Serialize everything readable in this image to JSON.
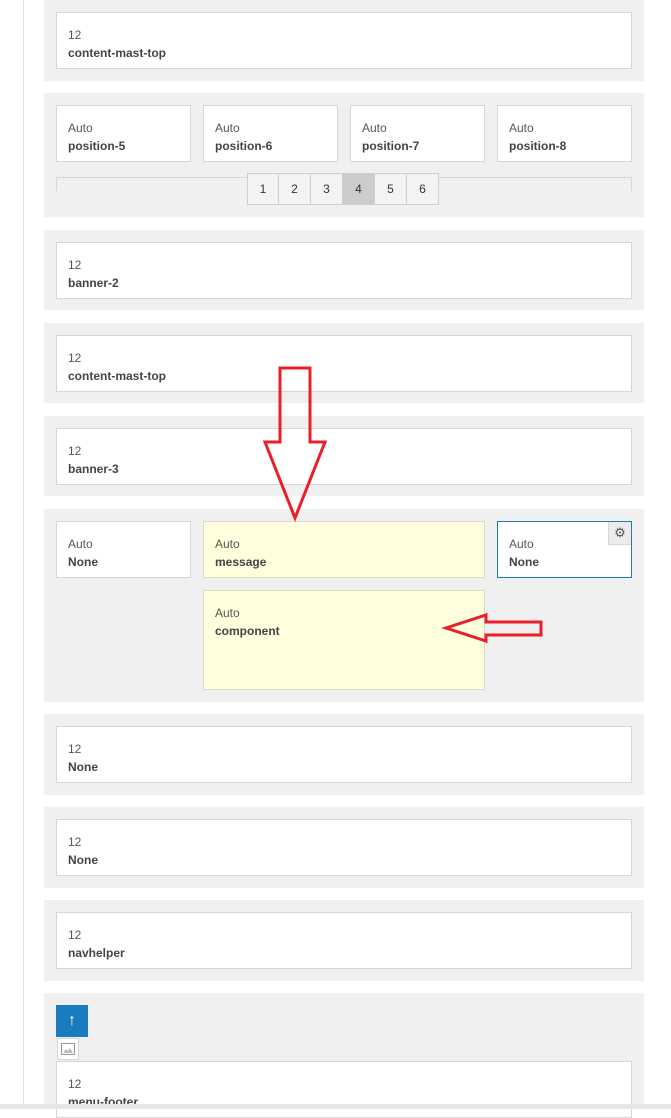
{
  "rows": [
    {
      "blocks": [
        {
          "width": "12",
          "name": "content-mast-top"
        }
      ]
    },
    {
      "blocks": [
        {
          "width": "Auto",
          "name": "position-5"
        },
        {
          "width": "Auto",
          "name": "position-6"
        },
        {
          "width": "Auto",
          "name": "position-7"
        },
        {
          "width": "Auto",
          "name": "position-8"
        }
      ],
      "pagination": {
        "pages": [
          "1",
          "2",
          "3",
          "4",
          "5",
          "6"
        ],
        "active": "4"
      }
    },
    {
      "blocks": [
        {
          "width": "12",
          "name": "banner-2"
        }
      ]
    },
    {
      "blocks": [
        {
          "width": "12",
          "name": "content-mast-top"
        }
      ]
    },
    {
      "blocks": [
        {
          "width": "12",
          "name": "banner-3"
        }
      ]
    },
    {
      "blocks": [
        {
          "width": "Auto",
          "name": "None"
        },
        {
          "width": "Auto",
          "name": "message"
        },
        {
          "width": "Auto",
          "name": "None"
        },
        {
          "width": "Auto",
          "name": "component"
        }
      ]
    },
    {
      "blocks": [
        {
          "width": "12",
          "name": "None"
        }
      ]
    },
    {
      "blocks": [
        {
          "width": "12",
          "name": "None"
        }
      ]
    },
    {
      "blocks": [
        {
          "width": "12",
          "name": "navhelper"
        }
      ]
    },
    {
      "blocks": [
        {
          "width": "12",
          "name": "menu-footer"
        }
      ]
    }
  ],
  "icons": {
    "gear": "gear-icon",
    "up": "arrow-up-icon",
    "image": "image-icon"
  },
  "colors": {
    "highlight_block": "#ffffdd",
    "selected_border": "#1e7dab",
    "annotation_arrow": "#e8202a",
    "up_button": "#1a7bc0",
    "row_background": "#f0f0f0"
  }
}
